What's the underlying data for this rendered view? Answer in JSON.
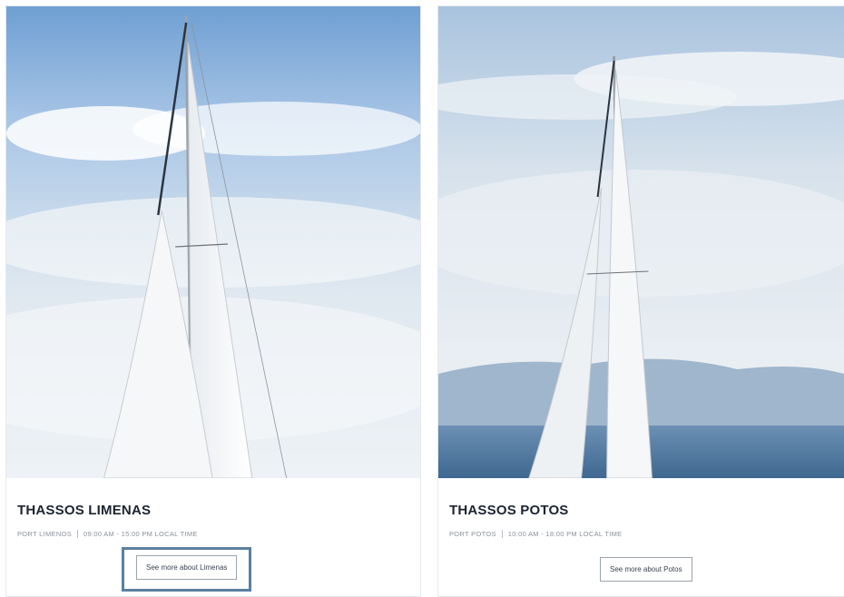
{
  "cards": [
    {
      "title": "THASSOS LIMENAS",
      "port": "PORT LIMENOS",
      "hours": "09:00 AM - 15:00 PM LOCAL TIME",
      "cta_label": "See more about Limenas"
    },
    {
      "title": "THASSOS POTOS",
      "port": "PORT POTOS",
      "hours": "10:00 AM - 18:00 PM LOCAL TIME",
      "cta_label": "See more about Potos"
    }
  ],
  "colors": {
    "focus_ring": "#5b7fa1",
    "sky_top": "#6f9fd3",
    "sea": "#4f79a3"
  }
}
